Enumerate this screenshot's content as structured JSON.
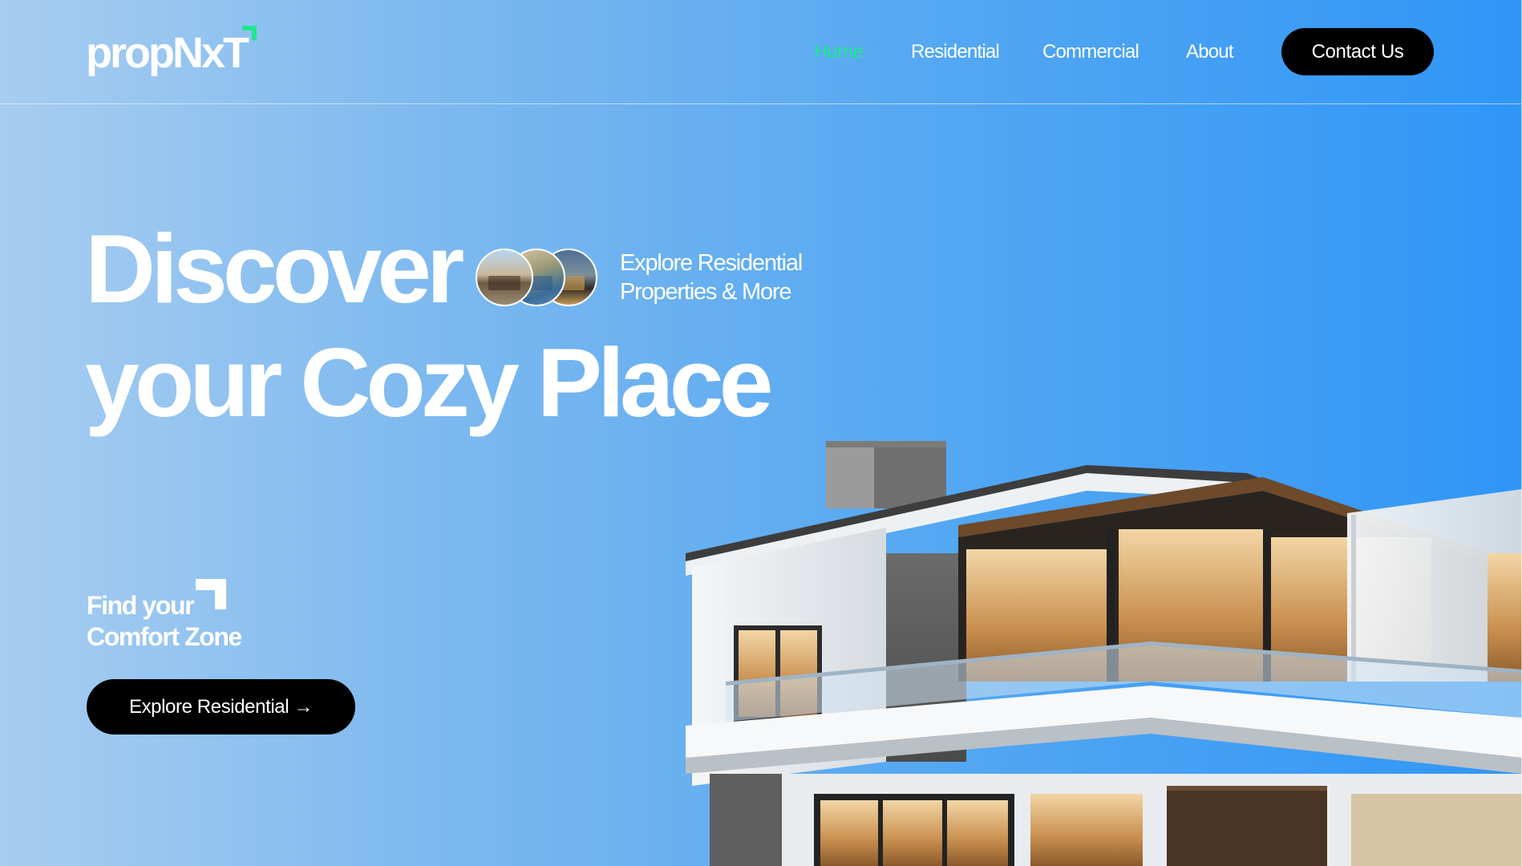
{
  "header": {
    "logo": "propNxT",
    "nav": [
      {
        "label": "Home",
        "active": true
      },
      {
        "label": "Residential",
        "active": false
      },
      {
        "label": "Commercial",
        "active": false
      },
      {
        "label": "About",
        "active": false
      }
    ],
    "contact_label": "Contact Us"
  },
  "hero": {
    "headline_line1": "Discover",
    "headline_line2": "your Cozy Place",
    "tagline_line1": "Explore Residential",
    "tagline_line2": "Properties & More",
    "find_line1": "Find your",
    "find_line2": "Comfort Zone",
    "explore_label": "Explore Residential →"
  },
  "colors": {
    "accent": "#1de88c",
    "gradient_start": "#a7cdf0",
    "gradient_end": "#2f96f6",
    "button": "#000000"
  },
  "icons": {
    "logo_mark": "corner-bracket-icon",
    "section_mark": "corner-bracket-icon",
    "arrow": "arrow-right-icon"
  }
}
